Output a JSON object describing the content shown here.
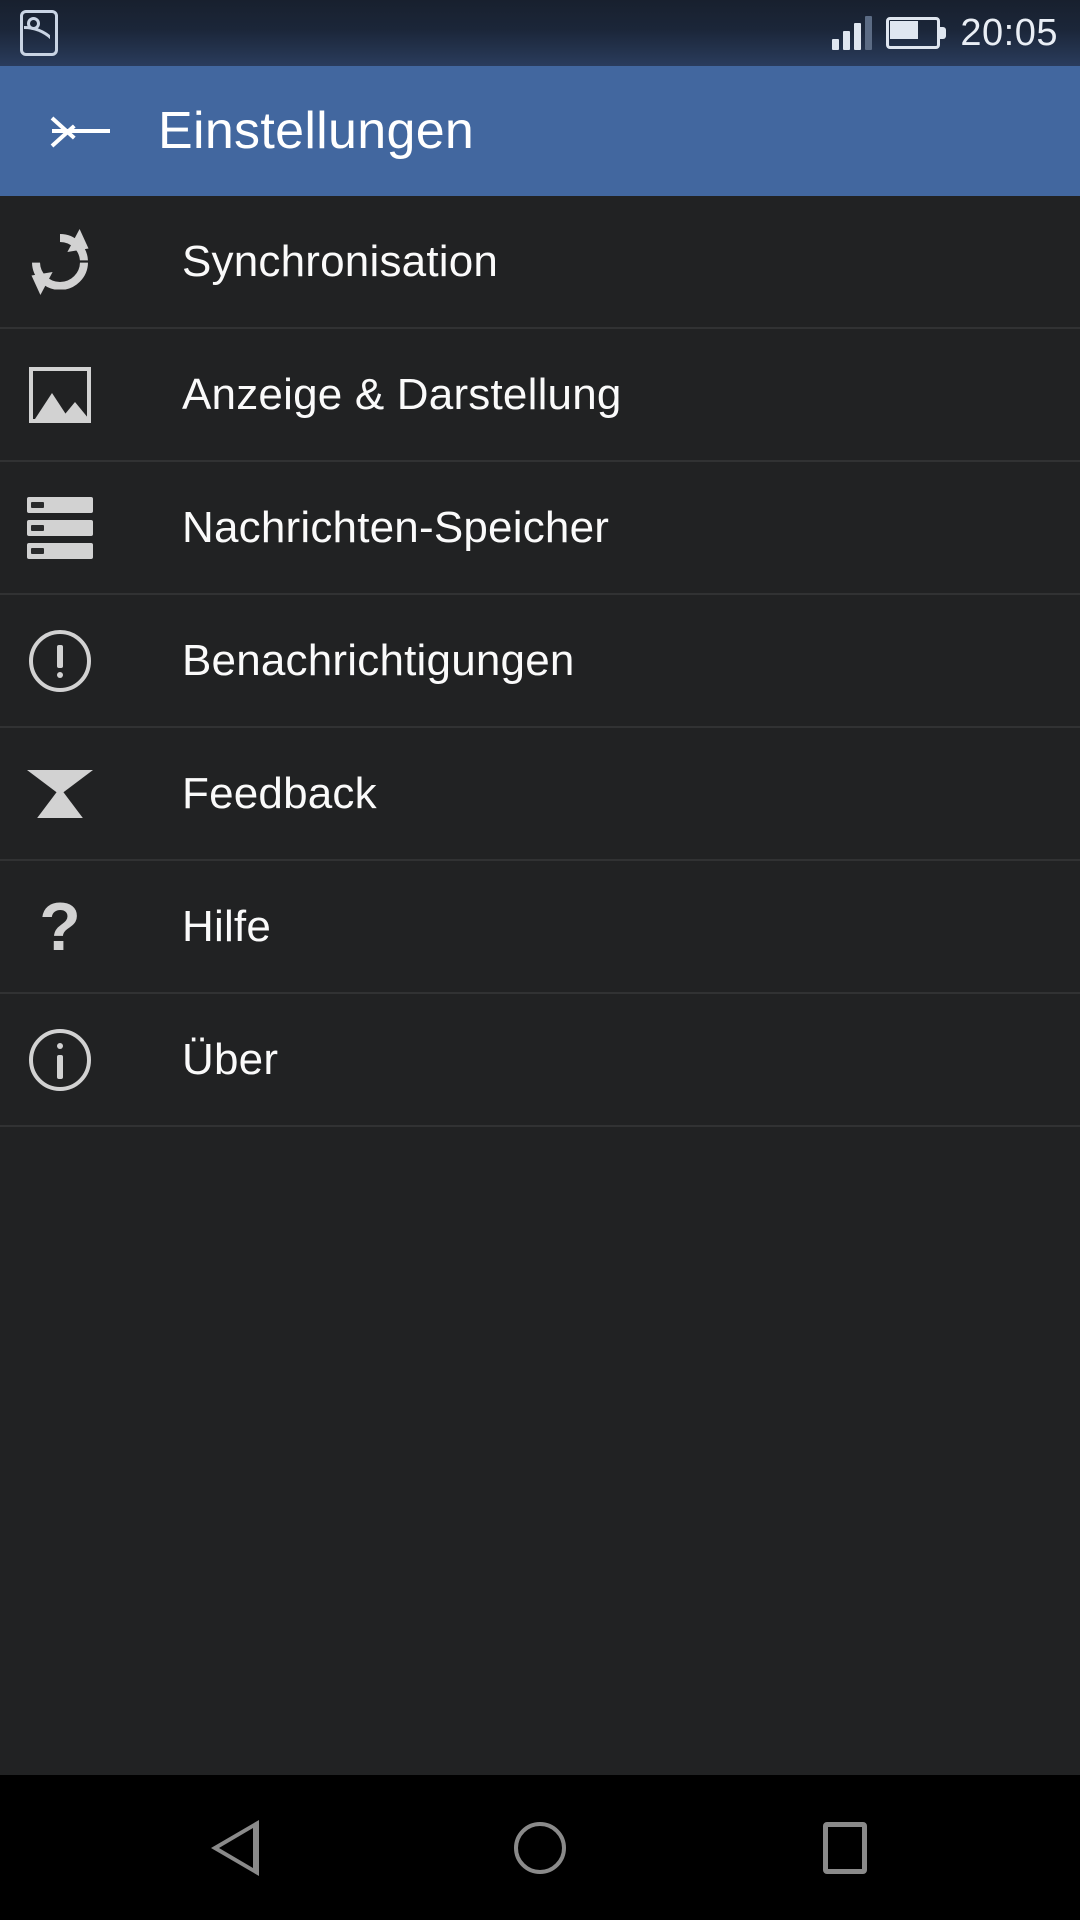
{
  "status_bar": {
    "left_icon": "photo-icon",
    "signal_icon": "signal-bars-icon",
    "signal_bars_filled": 3,
    "signal_bars_total": 4,
    "battery_icon": "battery-icon",
    "battery_level_percent": 60,
    "time": "20:05"
  },
  "app_bar": {
    "back_icon": "back-arrow-icon",
    "title": "Einstellungen",
    "background_color": "#42679f",
    "title_color": "#ffffff"
  },
  "settings_list": {
    "background_color": "#212223",
    "divider_color": "#313233",
    "text_color": "#fafafa",
    "icon_color": "#d2d2d2",
    "items": [
      {
        "label": "Synchronisation",
        "icon": "sync-icon"
      },
      {
        "label": "Anzeige & Darstellung",
        "icon": "image-icon"
      },
      {
        "label": "Nachrichten-Speicher",
        "icon": "storage-icon"
      },
      {
        "label": "Benachrichtigungen",
        "icon": "alert-circle-icon"
      },
      {
        "label": "Feedback",
        "icon": "envelope-icon"
      },
      {
        "label": "Hilfe",
        "icon": "question-mark-icon"
      },
      {
        "label": "Über",
        "icon": "info-circle-icon"
      }
    ]
  },
  "nav_bar": {
    "background_color": "#000000",
    "icon_color": "#8a8a8a",
    "buttons": [
      {
        "name": "back",
        "icon": "triangle-back-icon"
      },
      {
        "name": "home",
        "icon": "circle-home-icon"
      },
      {
        "name": "recents",
        "icon": "square-recents-icon"
      }
    ]
  },
  "help_glyph": "?"
}
